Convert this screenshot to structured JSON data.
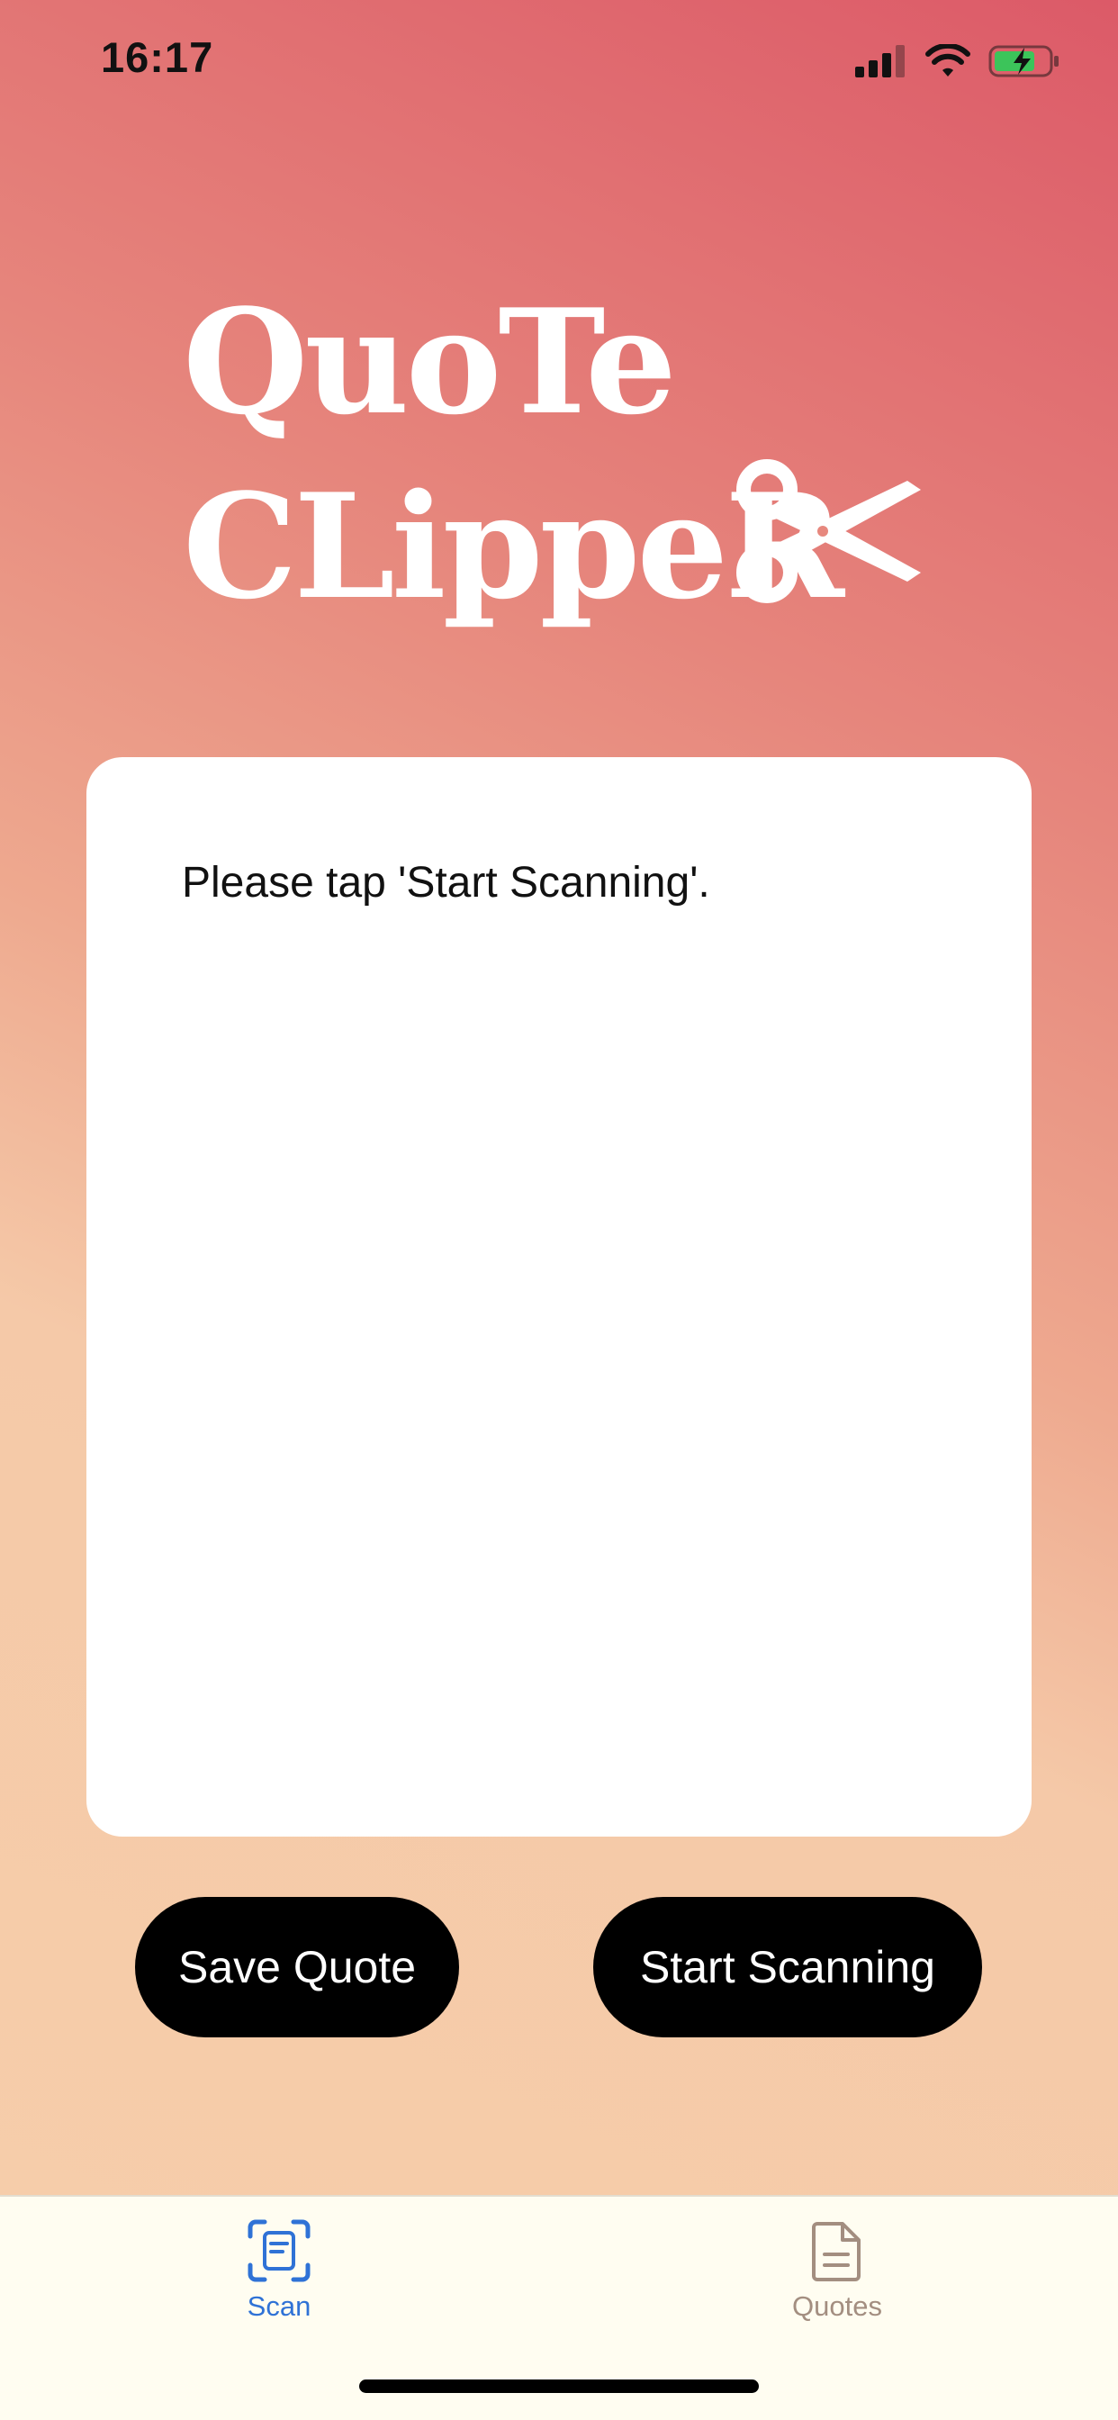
{
  "status_bar": {
    "time": "16:17",
    "icons": [
      "cellular-signal-icon",
      "wifi-icon",
      "battery-charging-icon"
    ]
  },
  "header": {
    "title_line1": "QuoTe",
    "title_line2": "CLippeR",
    "logo_icon": "scissors-icon"
  },
  "scan_card": {
    "message": "Please tap 'Start Scanning'."
  },
  "actions": {
    "save_label": "Save Quote",
    "start_label": "Start Scanning"
  },
  "tabbar": {
    "tabs": [
      {
        "label": "Scan",
        "icon": "scan-document-icon",
        "selected": true
      },
      {
        "label": "Quotes",
        "icon": "document-icon",
        "selected": false
      }
    ]
  },
  "colors": {
    "gradient_top": "#dc5a68",
    "gradient_bottom": "#f6ceaa",
    "tab_selected": "#2f72d6",
    "tab_unselected": "#a38e80",
    "button_bg": "#000000",
    "card_bg": "#ffffff"
  }
}
